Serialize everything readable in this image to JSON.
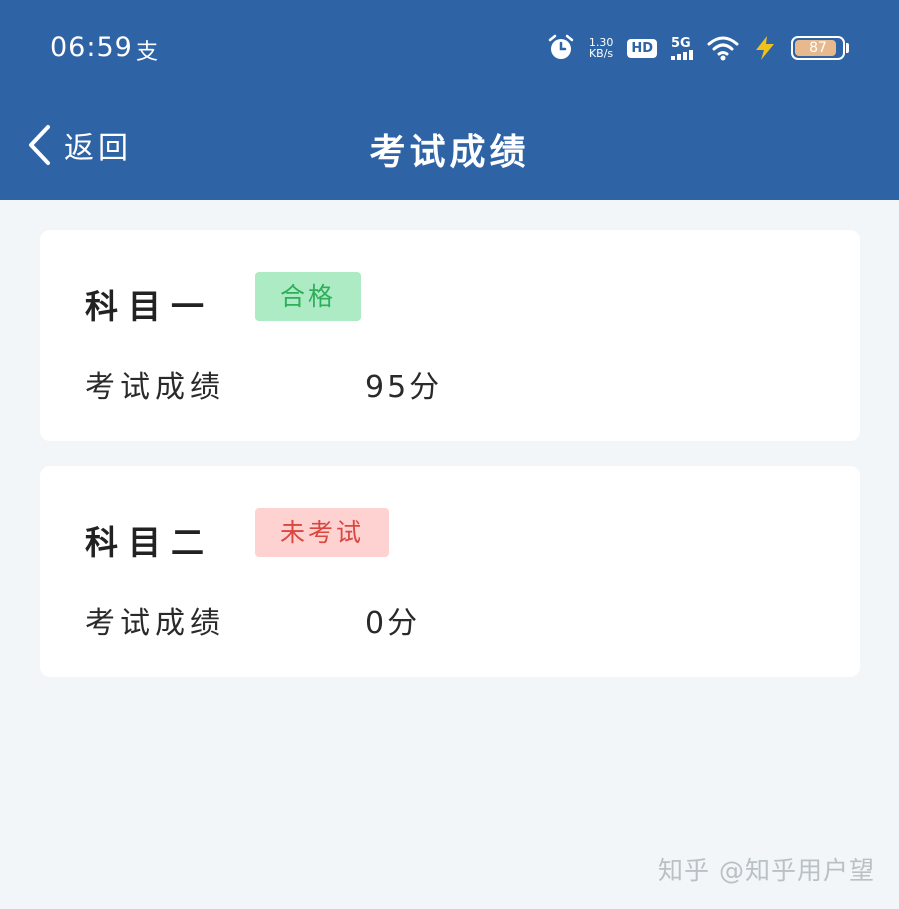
{
  "status_bar": {
    "time": "06:59",
    "extra": "支",
    "net_speed_value": "1.30",
    "net_speed_unit": "KB/s",
    "hd": "HD",
    "signal": "5G",
    "battery": "87",
    "icons": [
      "alarm-icon",
      "hd-icon",
      "signal-icon",
      "wifi-icon",
      "charging-icon",
      "battery-icon"
    ]
  },
  "nav": {
    "back_label": "返回",
    "title": "考试成绩"
  },
  "subjects": [
    {
      "name": "科目一",
      "status": "合格",
      "score_label": "考试成绩",
      "score_value": "95分"
    },
    {
      "name": "科目二",
      "status": "未考试",
      "score_label": "考试成绩",
      "score_value": "0分"
    }
  ],
  "colors": {
    "header": "#2e63a6",
    "pass_bg": "#acebc4",
    "pass_text": "#2fae5c",
    "fail_bg": "#ffd2d2",
    "fail_text": "#d9473f"
  },
  "watermark": "知乎 @知乎用户望"
}
